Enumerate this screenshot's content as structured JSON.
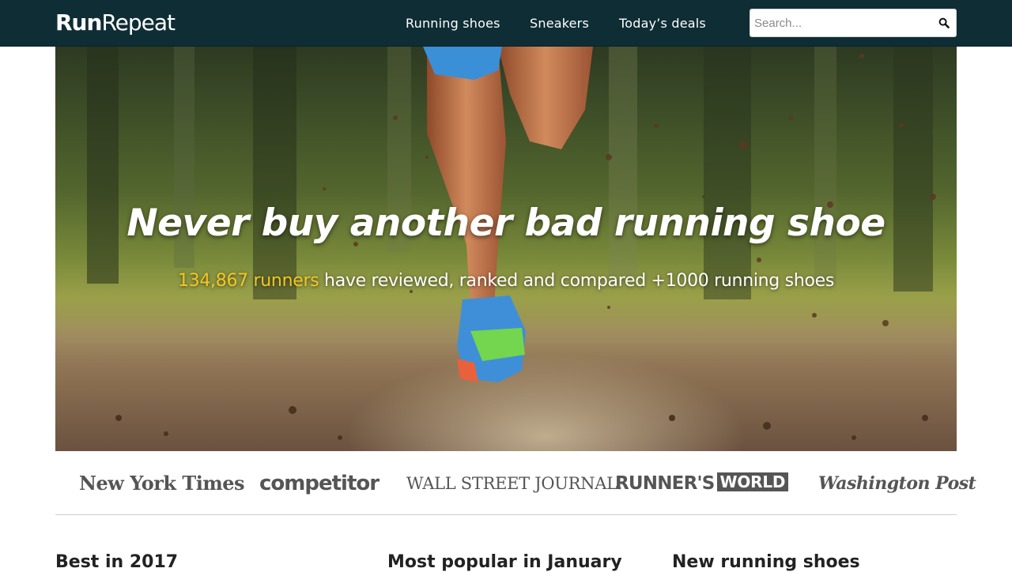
{
  "header": {
    "logo_bold": "Run",
    "logo_light": "Repeat",
    "nav": [
      "Running shoes",
      "Sneakers",
      "Today’s deals"
    ],
    "search": {
      "placeholder": "Search..."
    }
  },
  "hero": {
    "title": "Never buy another bad running shoe",
    "subtitle_count": "134,867 runners",
    "subtitle_rest": " have reviewed, ranked and compared +1000 running shoes"
  },
  "press": {
    "nyt": "New York Times",
    "competitor": "competitor",
    "wsj": "WALL STREET JOURNAL.",
    "rw_left": "RUNNER'S",
    "rw_right": "WORLD",
    "wp": "Washington Post"
  },
  "sections": [
    "Best in 2017",
    "Most popular in January",
    "New running shoes"
  ],
  "colors": {
    "header_bg": "#0f2d35",
    "accent_yellow": "#f5c623",
    "press_gray": "#555555"
  },
  "icons": {
    "search": "search-icon"
  }
}
